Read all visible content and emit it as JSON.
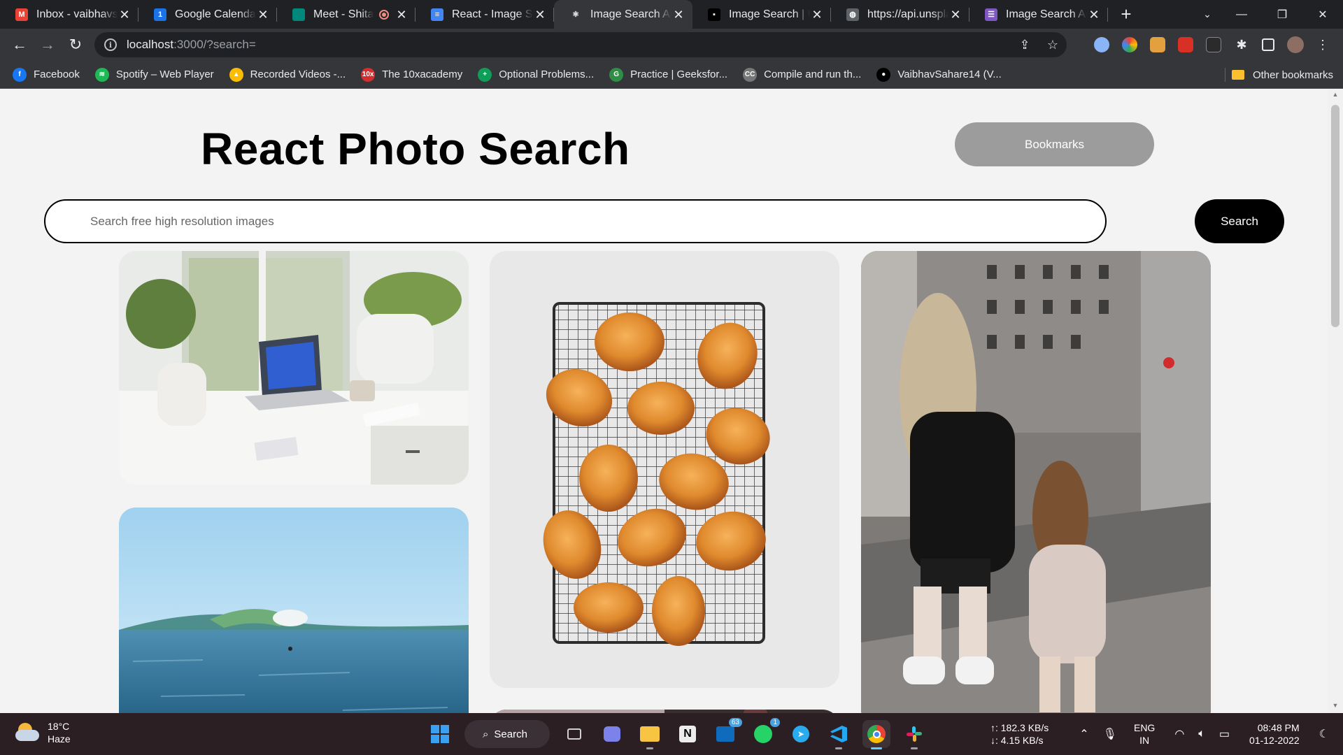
{
  "browser": {
    "tabs": [
      {
        "title": "Inbox - vaibhavsahare",
        "favicon": "gmail-icon",
        "color": "#ea4335",
        "glyph": "M"
      },
      {
        "title": "Google Calendar",
        "favicon": "calendar-icon",
        "color": "#1a73e8",
        "glyph": "1"
      },
      {
        "title": "Meet - Shital",
        "favicon": "meet-icon",
        "color": "#00897b",
        "glyph": ""
      },
      {
        "title": "React - Image Search",
        "favicon": "docs-icon",
        "color": "#4285f4",
        "glyph": "≡"
      },
      {
        "title": "Image Search App",
        "favicon": "react-icon",
        "color": "#35363a",
        "glyph": "⚛"
      },
      {
        "title": "Image Search | Unsplash",
        "favicon": "unsplash-icon",
        "color": "#000000",
        "glyph": "▪"
      },
      {
        "title": "https://api.unsplash.com",
        "favicon": "globe-icon",
        "color": "#5f6368",
        "glyph": "◍"
      },
      {
        "title": "Image Search App",
        "favicon": "forms-icon",
        "color": "#7e57c2",
        "glyph": "☰"
      }
    ],
    "url_host": "localhost",
    "url_path": ":3000/?search="
  },
  "bookmarks": [
    {
      "label": "Facebook",
      "icon": "facebook-icon",
      "color": "#1877f2",
      "glyph": "f"
    },
    {
      "label": "Spotify – Web Player",
      "icon": "spotify-icon",
      "color": "#1db954",
      "glyph": "≋"
    },
    {
      "label": "Recorded Videos -...",
      "icon": "drive-icon",
      "color": "#fbbc04",
      "glyph": "▲"
    },
    {
      "label": "The 10xacademy",
      "icon": "10x-icon",
      "color": "#d32f2f",
      "glyph": "10x"
    },
    {
      "label": "Optional Problems...",
      "icon": "sheets-icon",
      "color": "#0f9d58",
      "glyph": "+"
    },
    {
      "label": "Practice | Geeksfor...",
      "icon": "gfg-icon",
      "color": "#2f8d46",
      "glyph": "G"
    },
    {
      "label": "Compile and run th...",
      "icon": "compiler-icon",
      "color": "#777777",
      "glyph": "CC"
    },
    {
      "label": "VaibhavSahare14 (V...",
      "icon": "github-icon",
      "color": "#000000",
      "glyph": "●"
    }
  ],
  "other_bookmarks": "Other bookmarks",
  "app": {
    "title": "React Photo Search",
    "bookmarks_button": "Bookmarks",
    "search_placeholder": "Search free high resolution images",
    "search_button": "Search"
  },
  "taskbar": {
    "temperature": "18°C",
    "condition": "Haze",
    "search_label": "Search",
    "upload_speed": "↑: 182.3 KB/s",
    "download_speed": "↓: 4.15 KB/s",
    "lang_top": "ENG",
    "lang_bottom": "IN",
    "time": "08:48 PM",
    "date": "01-12-2022",
    "badges": {
      "outlook": "63",
      "whatsapp": "1"
    }
  }
}
